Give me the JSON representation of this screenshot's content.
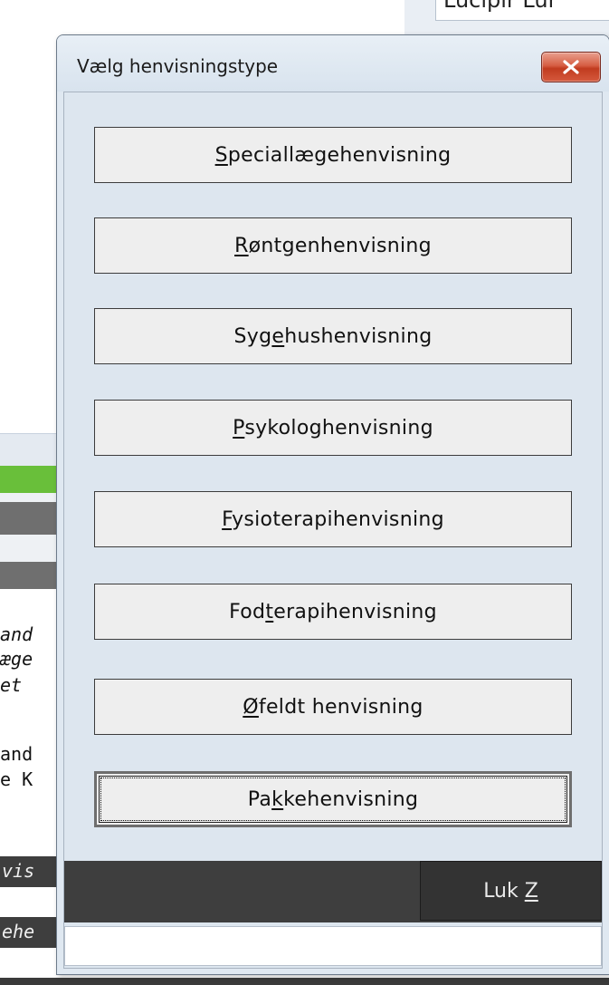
{
  "background": {
    "top_field_text": "Lucipir Lur",
    "left_lines": [
      {
        "text": "and",
        "italic": true
      },
      {
        "text": "æge",
        "italic": true
      },
      {
        "text": "et",
        "italic": true
      },
      {
        "text": "and",
        "italic": false
      },
      {
        "text": "e K",
        "italic": false
      }
    ],
    "dark_rows": [
      "vis",
      "ehe"
    ]
  },
  "dialog": {
    "title": "Vælg henvisningstype",
    "buttons": [
      {
        "pre": "",
        "key": "S",
        "post": "peciallægehenvisning"
      },
      {
        "pre": "",
        "key": "R",
        "post": "øntgenhenvisning"
      },
      {
        "pre": "Syg",
        "key": "e",
        "post": "hushenvisning"
      },
      {
        "pre": "",
        "key": "P",
        "post": "sykologhenvisning"
      },
      {
        "pre": "",
        "key": "F",
        "post": "ysioterapihenvisning"
      },
      {
        "pre": "Fod",
        "key": "t",
        "post": "erapihenvisning"
      },
      {
        "pre": "",
        "key": "Ø",
        "post": "feldt henvisning"
      },
      {
        "pre": "Pa",
        "key": "k",
        "post": "kehenvisning"
      }
    ],
    "close_label": {
      "pre": "Luk ",
      "key": "Z"
    },
    "status_text": "",
    "colors": {
      "close_button": "#c13b1f",
      "dialog_bg": "#dfe8f1",
      "green_bar": "#69bf3a",
      "footer": "#3e3e3e"
    },
    "icons": {
      "close": "close-x-icon"
    }
  }
}
